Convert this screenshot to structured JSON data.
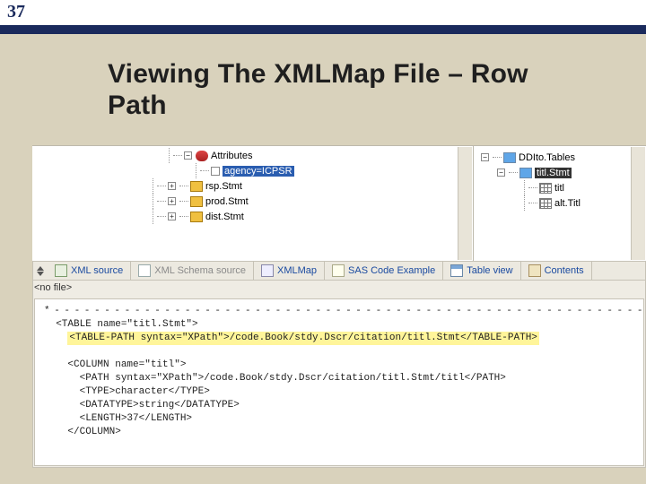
{
  "header": {
    "logo": "37",
    "title_line1": "Viewing The XMLMap File – Row",
    "title_line2": "Path"
  },
  "leftTree": {
    "attributes_label": "Attributes",
    "agency_attr": "agency=ICPSR",
    "items": [
      "rsp.Stmt",
      "prod.Stmt",
      "dist.Stmt"
    ]
  },
  "rightTree": {
    "root": "DDIto.Tables",
    "table_item": "titl.Stmt",
    "col_items": [
      "titl",
      "alt.Titl"
    ]
  },
  "tabs": {
    "xml_source": "XML source",
    "schema_source": "XML Schema source",
    "xmlmap": "XMLMap",
    "sas_code": "SAS Code Example",
    "table_view": "Table view",
    "contents": "Contents"
  },
  "status": {
    "no_file": "<no file>"
  },
  "code": {
    "dashes": "* - - - - - - - - - - - - - - - - - - - - - - - - - - - - - - - - - - - - - - - - - - - - - - - - - - - - - - - - - - - - - - - - - - - - - - - - - - - - - - - - - - - - - - - - - - - - - - - - - - - - - - - - - - - - - - - - - - - - - - - - - - - - - - - - - - - - - - - - - - */",
    "l1": "<TABLE name=\"titl.Stmt\">",
    "l2": "<TABLE-PATH syntax=\"XPath\">/code.Book/stdy.Dscr/citation/titl.Stmt</TABLE-PATH>",
    "l3": "",
    "l4": "<COLUMN name=\"titl\">",
    "l5": "<PATH syntax=\"XPath\">/code.Book/stdy.Dscr/citation/titl.Stmt/titl</PATH>",
    "l6": "<TYPE>character</TYPE>",
    "l7": "<DATATYPE>string</DATATYPE>",
    "l8": "<LENGTH>37</LENGTH>",
    "l9": "</COLUMN>"
  }
}
